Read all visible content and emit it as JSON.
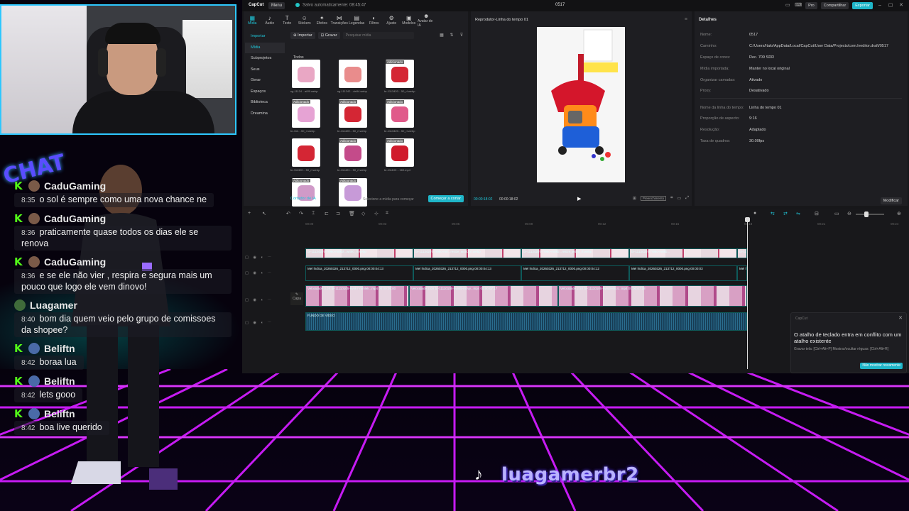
{
  "capcut": {
    "app_name": "CapCut",
    "menu": "Menu",
    "autosave": "Salvo automaticamente: 08:45:47",
    "project_title": "0517",
    "pro_label": "Pro",
    "share_label": "Compartilhar",
    "export_label": "Exportar",
    "tools": [
      "Mídia",
      "Áudio",
      "Texto",
      "Stickers",
      "Efeitos",
      "Transições",
      "Legendas",
      "Filtros",
      "Ajuste",
      "Modelos",
      "Avatar de IA"
    ],
    "sidenav": [
      "Importar",
      "Mídia",
      "Subprojetos",
      "Seus",
      "Gerar",
      "Espaços",
      "Biblioteca",
      "Dreamina"
    ],
    "import_btn": "Importar",
    "record_btn": "Gravar",
    "search_placeholder": "Pesquisar mídia",
    "all_label": "Todos",
    "media_items": [
      {
        "cap": "sg-11124…a0f9.webp",
        "tag": "",
        "dur": ""
      },
      {
        "cap": "sg-111242…de84.webp",
        "tag": "",
        "dur": ""
      },
      {
        "cap": "br-1113420…50_rl.webp",
        "tag": "Adicionado",
        "dur": ""
      },
      {
        "cap": "br-111…50_rl.webp",
        "tag": "Adicionado",
        "dur": ""
      },
      {
        "cap": "br-111420…50_rl.webp",
        "tag": "Adicionado",
        "dur": ""
      },
      {
        "cap": "br-1113420…50_rl.webp",
        "tag": "Adicionado",
        "dur": ""
      },
      {
        "cap": "br-111320…50_rl.webp",
        "tag": "",
        "dur": ""
      },
      {
        "cap": "br-111421…50_rl.webp",
        "tag": "Adicionado",
        "dur": ""
      },
      {
        "cap": "br-111100…169.mp4",
        "tag": "Adicionado",
        "dur": "00:09"
      },
      {
        "cap": "",
        "tag": "Adicionado",
        "dur": "00:10"
      },
      {
        "cap": "",
        "tag": "Adicionado",
        "dur": "00:12"
      }
    ],
    "ai_cut": "Cortador de IA",
    "ai_hint": "Selecione a mídia para começar",
    "ai_btn": "Começar a cortar",
    "player_title": "Reprodutor-Linha do tempo 01",
    "player_time_current": "00:00:18:02",
    "player_time_total": "00:00:18:02",
    "player_tag": "Preenchimento",
    "details_title": "Detalhes",
    "details": [
      {
        "k": "Nome:",
        "v": "0517"
      },
      {
        "k": "Caminho:",
        "v": "C:/Users/Italo/AppData/Local/CapCut/User Data/Projects/com.lveditor.draft/0517"
      },
      {
        "k": "Espaço de cores:",
        "v": "Rec. 709 SDR"
      },
      {
        "k": "Mídia importada:",
        "v": "Manter no local original"
      },
      {
        "k": "Organizar camadas:",
        "v": "Ativado"
      },
      {
        "k": "Proxy:",
        "v": "Desativado"
      },
      {
        "k": "Nome da linha do tempo:",
        "v": "Linha do tempo 01"
      },
      {
        "k": "Proporção de aspecto:",
        "v": "9:16"
      },
      {
        "k": "Resolução:",
        "v": "Adaptado"
      },
      {
        "k": "Taxa de quadros:",
        "v": "30.00fps"
      }
    ],
    "modify_btn": "Modificar",
    "ruler": [
      "00:00",
      "00:03",
      "00:06",
      "00:09",
      "00:12",
      "00:15",
      "00:18",
      "00:21",
      "00:24"
    ],
    "cover_label": "Capa",
    "track1_clips": [
      "br-11134207-7r98o-m8kbl...w450_rl.webp",
      "br-11134207-7r98o-m8...resize_w450_rl.webp",
      "br-11134207-7r98o-m8kb...resize_w450_rl.webp",
      "br-11134207-7r98o-m8kb...",
      "br-11134207-7r98o"
    ],
    "track2_clips": [
      "Mel Índica_20260326_213712_0000.png 00:00:04:13",
      "Mel Índica_20260326_213712_0000.png 00:00:04:13",
      "Mel Índica_20260326_213712_0000.png 00:00:04:12",
      "Mel Índica_20260326_213712_0000.png 00:00:03",
      "Mel Índica_20260"
    ],
    "track3_clips": [
      "Velocidade 3.0X br-11110105-6v6k7-mmlek...mp4 00:00:05:00",
      "Velocidade 2.0X br-11110105-6v6k5-mbvy...mp4 00:00:07:17",
      "Velocidade 2.5X br-11110105-6v6d4-mc4...mp4 00:00:07:18"
    ],
    "audio_clip": "FUNDO DE VÍDEO",
    "toast_header": "CapCut",
    "toast_msg": "O atalho de teclado entra em conflito com um atalho existente",
    "toast_sub": "Gravar tela: [Ctrl+Alt+P] Mostrar/ocultar réguas: [Ctrl+Alt+R]",
    "toast_btn": "Não mostrar novamente"
  },
  "chat": {
    "messages": [
      {
        "user": "CaduGaming",
        "time": "8:35",
        "text": "o sol é sempre como uma nova chance ne",
        "badge": "K",
        "avatar": "#7a5a48"
      },
      {
        "user": "CaduGaming",
        "time": "8:36",
        "text": "praticamente quase todos os dias ele se renova",
        "badge": "K",
        "avatar": "#7a5a48"
      },
      {
        "user": "CaduGaming",
        "time": "8:36",
        "text": "e se ele não vier , respira e segura mais um pouco que logo ele vem dinovo!",
        "badge": "K",
        "avatar": "#7a5a48"
      },
      {
        "user": "Luagamer",
        "time": "8:40",
        "text": "bom dia quem veio pelo grupo de comissoes da shopee?",
        "badge": "",
        "avatar": "#3f6b3a"
      },
      {
        "user": "Beliftn",
        "time": "8:42",
        "text": "boraa lua",
        "badge": "K",
        "avatar": "#4a6aa8"
      },
      {
        "user": "Beliftn",
        "time": "8:42",
        "text": "lets gooo",
        "badge": "K",
        "avatar": "#4a6aa8"
      },
      {
        "user": "Beliftn",
        "time": "8:42",
        "text": "boa live querido",
        "badge": "K",
        "avatar": "#4a6aa8"
      }
    ],
    "logo": "CHAT"
  },
  "social": {
    "tiktok_handle": "luagamerbr2",
    "tiktok_icon": "tiktok-icon"
  },
  "colors": {
    "accent": "#1fc6d9",
    "grid_magenta": "#d11dff",
    "webcam_border": "#2ec7ff",
    "kick_green": "#53fc18"
  }
}
